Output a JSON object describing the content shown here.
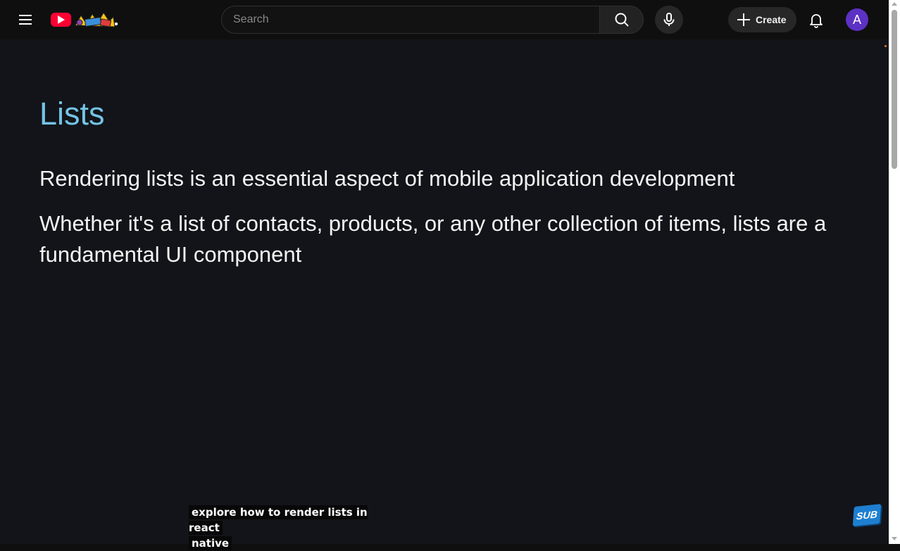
{
  "header": {
    "search": {
      "placeholder": "Search",
      "value": ""
    },
    "create_label": "Create",
    "avatar_initial": "A",
    "brand_color": "#ff0033",
    "avatar_color": "#5c31c4"
  },
  "slide": {
    "title": "Lists",
    "paragraph_1": "Rendering lists is an essential aspect of mobile application development",
    "paragraph_2": "Whether it's a list of contacts, products, or any other collection of items, lists are a fundamental UI component",
    "title_color": "#74c3e6",
    "background_color": "#121419"
  },
  "captions": {
    "line_1": "explore how to render lists in react",
    "line_2": "native"
  },
  "watermark": {
    "label": "SUB"
  },
  "icons": {
    "menu": "hamburger-menu-icon",
    "logo": "youtube-logo-icon",
    "search": "search-icon",
    "mic": "microphone-icon",
    "create": "plus-icon",
    "notifications": "bell-icon"
  }
}
